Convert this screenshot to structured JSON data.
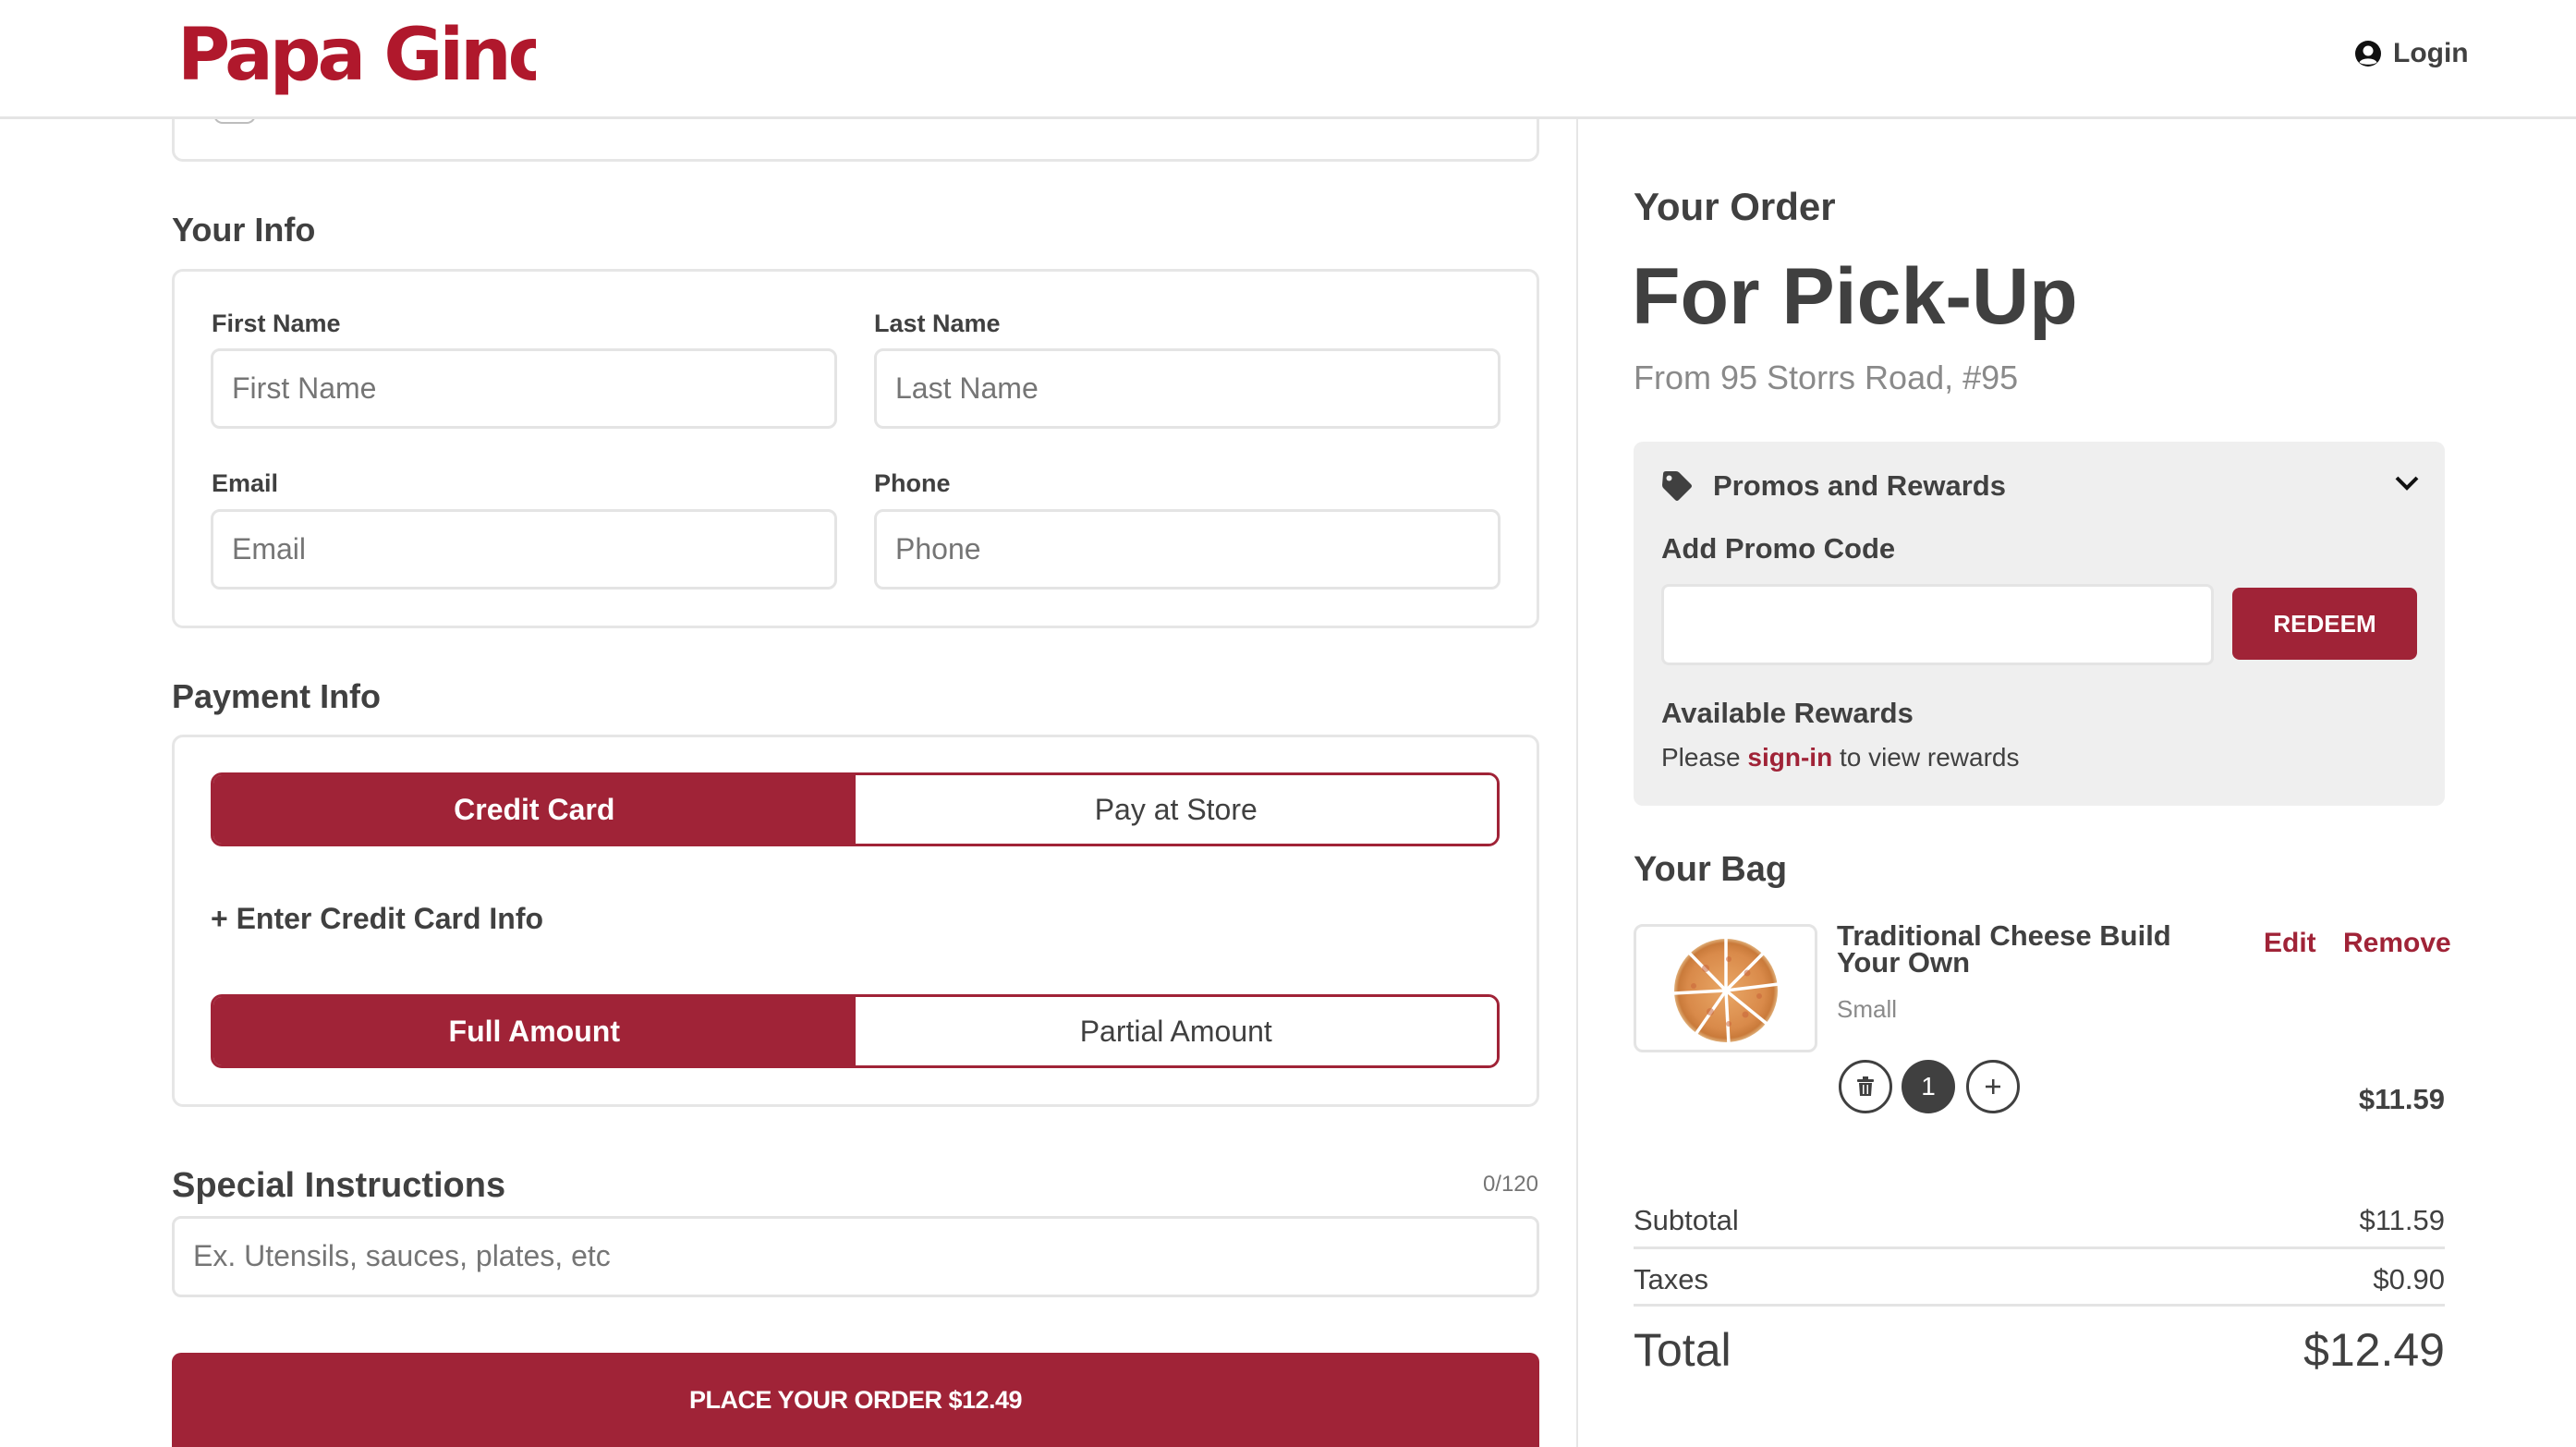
{
  "header": {
    "brand": "Papa Gino's",
    "login_label": "Login",
    "login_icon": "user-circle-icon"
  },
  "colors": {
    "brand_red": "#a02337",
    "logo_red": "#b0182c",
    "text_dark": "#404040",
    "text_muted": "#8a8a8a",
    "panel_gray": "#efefef",
    "border_gray": "#e4e4e4"
  },
  "your_info": {
    "heading": "Your Info",
    "fields": [
      {
        "label": "First Name",
        "placeholder": "First Name",
        "value": ""
      },
      {
        "label": "Last Name",
        "placeholder": "Last Name",
        "value": ""
      },
      {
        "label": "Email",
        "placeholder": "Email",
        "value": ""
      },
      {
        "label": "Phone",
        "placeholder": "Phone",
        "value": ""
      }
    ]
  },
  "payment_info": {
    "heading": "Payment Info",
    "method_options": [
      {
        "label": "Credit Card",
        "selected": true
      },
      {
        "label": "Pay at Store",
        "selected": false
      }
    ],
    "enter_card_label": "+ Enter Credit Card Info",
    "amount_options": [
      {
        "label": "Full Amount",
        "selected": true
      },
      {
        "label": "Partial Amount",
        "selected": false
      }
    ]
  },
  "special_instructions": {
    "heading": "Special Instructions",
    "char_count": "0/120",
    "placeholder": "Ex. Utensils, sauces, plates, etc",
    "value": ""
  },
  "place_order": {
    "label": "PLACE YOUR ORDER $12.49"
  },
  "order": {
    "heading": "Your Order",
    "mode": "For Pick-Up",
    "from": "From 95 Storrs Road, #95"
  },
  "promos": {
    "title": "Promos and Rewards",
    "tag_icon": "tag-icon",
    "chevron_icon": "chevron-down-icon",
    "add_code_label": "Add Promo Code",
    "code_value": "",
    "redeem_label": "REDEEM",
    "rewards_heading": "Available Rewards",
    "rewards_prefix": "Please ",
    "rewards_link": "sign-in",
    "rewards_suffix": " to view rewards"
  },
  "bag": {
    "heading": "Your Bag",
    "items": [
      {
        "name": "Traditional Cheese Build Your Own",
        "size": "Small",
        "quantity": "1",
        "price": "$11.59",
        "edit_label": "Edit",
        "remove_label": "Remove",
        "image": "cheese-pizza"
      }
    ]
  },
  "summary": {
    "subtotal_label": "Subtotal",
    "subtotal_value": "$11.59",
    "taxes_label": "Taxes",
    "taxes_value": "$0.90",
    "total_label": "Total",
    "total_value": "$12.49"
  }
}
